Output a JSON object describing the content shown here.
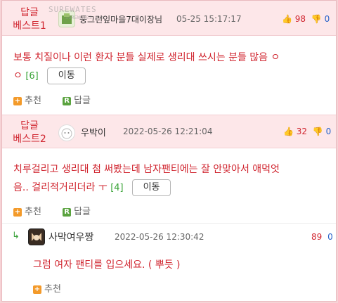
{
  "comments": [
    {
      "badge_line1": "답글",
      "badge_line2": "베스트1",
      "nickname": "둥그런잎마을7대이장님",
      "date": "05-25 15:17:17",
      "up": "98",
      "down": "0",
      "text_line1": "보통 치질이나 이런 환자 분들 실제로 생리대 쓰시는 분들 많음 ㅇ",
      "text_line2": "ㅇ",
      "reply_count": "[6]",
      "move_label": "이동",
      "recommend_label": "추천",
      "reply_label": "답글"
    },
    {
      "badge_line1": "답글",
      "badge_line2": "베스트2",
      "nickname": "우박이",
      "date": "2022-05-26 12:21:04",
      "up": "32",
      "down": "0",
      "text_line1": "치루걸리고 생리대 첨 써봤는데 남자팬티에는 잘 안맞아서 애먹엇",
      "text_line2": "음.. 걸리적거리더라 ㅜ",
      "reply_count": "[4]",
      "move_label": "이동",
      "recommend_label": "추천",
      "reply_label": "답글"
    }
  ],
  "reply": {
    "nickname": "사막여우짱",
    "date": "2022-05-26 12:30:42",
    "score": "89",
    "down": "0",
    "text": "그럼 여자 팬티를 입으세요. ( 뿌듯 )",
    "recommend_label": "추천"
  },
  "watermark": "SUREWATES",
  "watermark_sub": "SUREWATES.com",
  "colors": {
    "best_bg": "#fde7e9",
    "red": "#d0252f",
    "blue": "#2762c9",
    "green": "#38a336"
  }
}
